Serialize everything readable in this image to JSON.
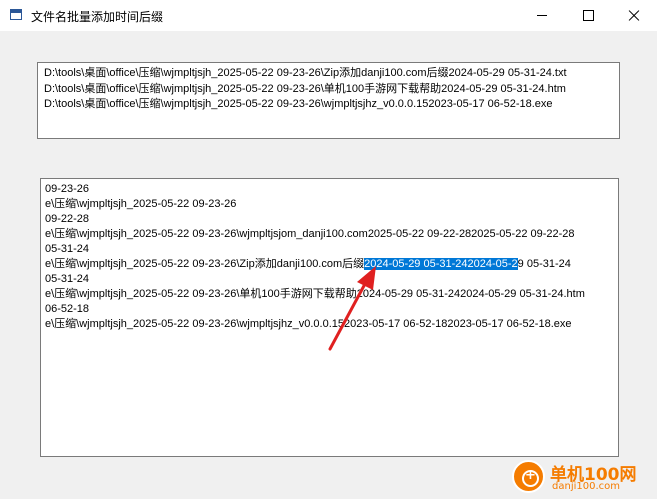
{
  "window": {
    "title": "文件名批量添加时间后缀",
    "icon": "window-icon",
    "controls": [
      "minimize-icon",
      "maximize-icon",
      "close-icon"
    ]
  },
  "input_box": {
    "lines": [
      "D:\\tools\\桌面\\office\\压缩\\wjmpltjsjh_2025-05-22 09-23-26\\Zip添加danji100.com后缀2024-05-29 05-31-24.txt",
      "D:\\tools\\桌面\\office\\压缩\\wjmpltjsjh_2025-05-22 09-23-26\\单机100手游网下载帮助2024-05-29 05-31-24.htm",
      "D:\\tools\\桌面\\office\\压缩\\wjmpltjsjh_2025-05-22 09-23-26\\wjmpltjsjhz_v0.0.0.152023-05-17 06-52-18.exe"
    ]
  },
  "output_box": {
    "lines": [
      "09-23-26",
      "e\\压缩\\wjmpltjsjh_2025-05-22 09-23-26",
      "09-22-28",
      "e\\压缩\\wjmpltjsjh_2025-05-22 09-23-26\\wjmpltjsjom_danji100.com2025-05-22 09-22-282025-05-22 09-22-28",
      "05-31-24"
    ],
    "highlight_line": {
      "before": "e\\压缩\\wjmpltjsjh_2025-05-22 09-23-26\\Zip添加danji100.com后缀",
      "selected": "2024-05-29 05-31-242024-05-2",
      "after": "9 05-31-24"
    },
    "lines_after": [
      "05-31-24",
      "e\\压缩\\wjmpltjsjh_2025-05-22 09-23-26\\单机100手游网下载帮助2024-05-29 05-31-242024-05-29 05-31-24.htm",
      "06-52-18",
      "e\\压缩\\wjmpltjsjh_2025-05-22 09-23-26\\wjmpltjsjhz_v0.0.0.152023-05-17 06-52-182023-05-17 06-52-18.exe"
    ]
  },
  "annotation": {
    "arrow_color": "#e02020"
  },
  "watermark": {
    "name": "单机100网",
    "url": "danji100.com",
    "color": "#f57c00"
  }
}
